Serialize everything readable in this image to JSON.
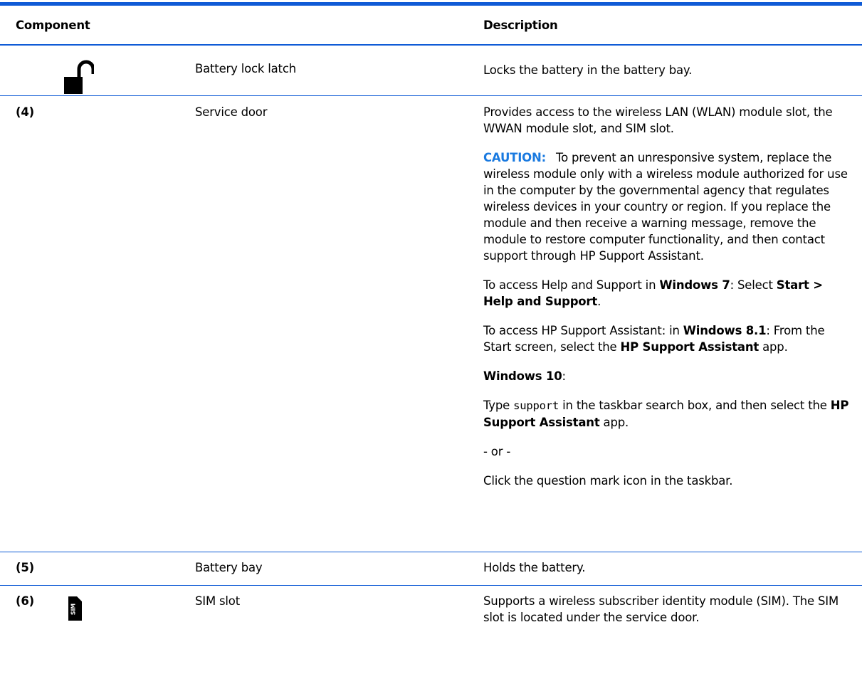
{
  "table": {
    "headers": {
      "component": "Component",
      "description": "Description"
    },
    "rows": [
      {
        "number": "",
        "icon": "battery-lock-latch-icon",
        "name": "Battery lock latch",
        "description": "Locks the battery in the battery bay."
      },
      {
        "number": "(4)",
        "icon": "",
        "name": "Service door",
        "description": {
          "p1": "Provides access to the wireless LAN (WLAN) module slot, the WWAN module slot, and SIM slot.",
          "caution_label": "CAUTION:",
          "caution_text": "To prevent an unresponsive system, replace the wireless module only with a wireless module authorized for use in the computer by the governmental agency that regulates wireless devices in your country or region. If you replace the module and then receive a warning message, remove the module to restore computer functionality, and then contact support through HP Support Assistant.",
          "p3_a": "To access Help and Support in ",
          "p3_b": "Windows 7",
          "p3_c": ": Select ",
          "p3_d": "Start > Help and Support",
          "p3_e": ".",
          "p4_a": "To access HP Support Assistant: in ",
          "p4_b": "Windows 8.1",
          "p4_c": ": From the Start screen, select the ",
          "p4_d": "HP Support Assistant",
          "p4_e": " app.",
          "p5_a": "Windows 10",
          "p5_b": ":",
          "p6_a": "Type ",
          "p6_code": "support",
          "p6_b": " in the taskbar search box, and then select the ",
          "p6_c": "HP Support Assistant",
          "p6_d": " app.",
          "p7": "- or -",
          "p8": "Click the question mark icon in the taskbar."
        }
      },
      {
        "number": "(5)",
        "icon": "",
        "name": "Battery bay",
        "description": "Holds the battery."
      },
      {
        "number": "(6)",
        "icon": "sim-card-icon",
        "name": "SIM slot",
        "description": "Supports a wireless subscriber identity module (SIM). The SIM slot is located under the service door."
      }
    ]
  },
  "colors": {
    "rule": "#0f5bd6",
    "caution": "#1a7ae0"
  }
}
